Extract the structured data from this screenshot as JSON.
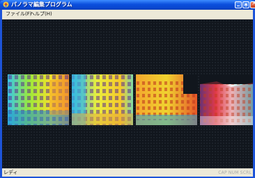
{
  "window": {
    "title": "パノラマ編集プログラム"
  },
  "menu": {
    "items": [
      "ファイル(F)",
      "ヘルプ(H)"
    ]
  },
  "status": {
    "left": "レディ",
    "right": "CAP NUM SCRL"
  },
  "colors": {
    "titlebar": "#0b4fdd",
    "workspace": "#141a22",
    "chrome": "#ece9d8"
  }
}
